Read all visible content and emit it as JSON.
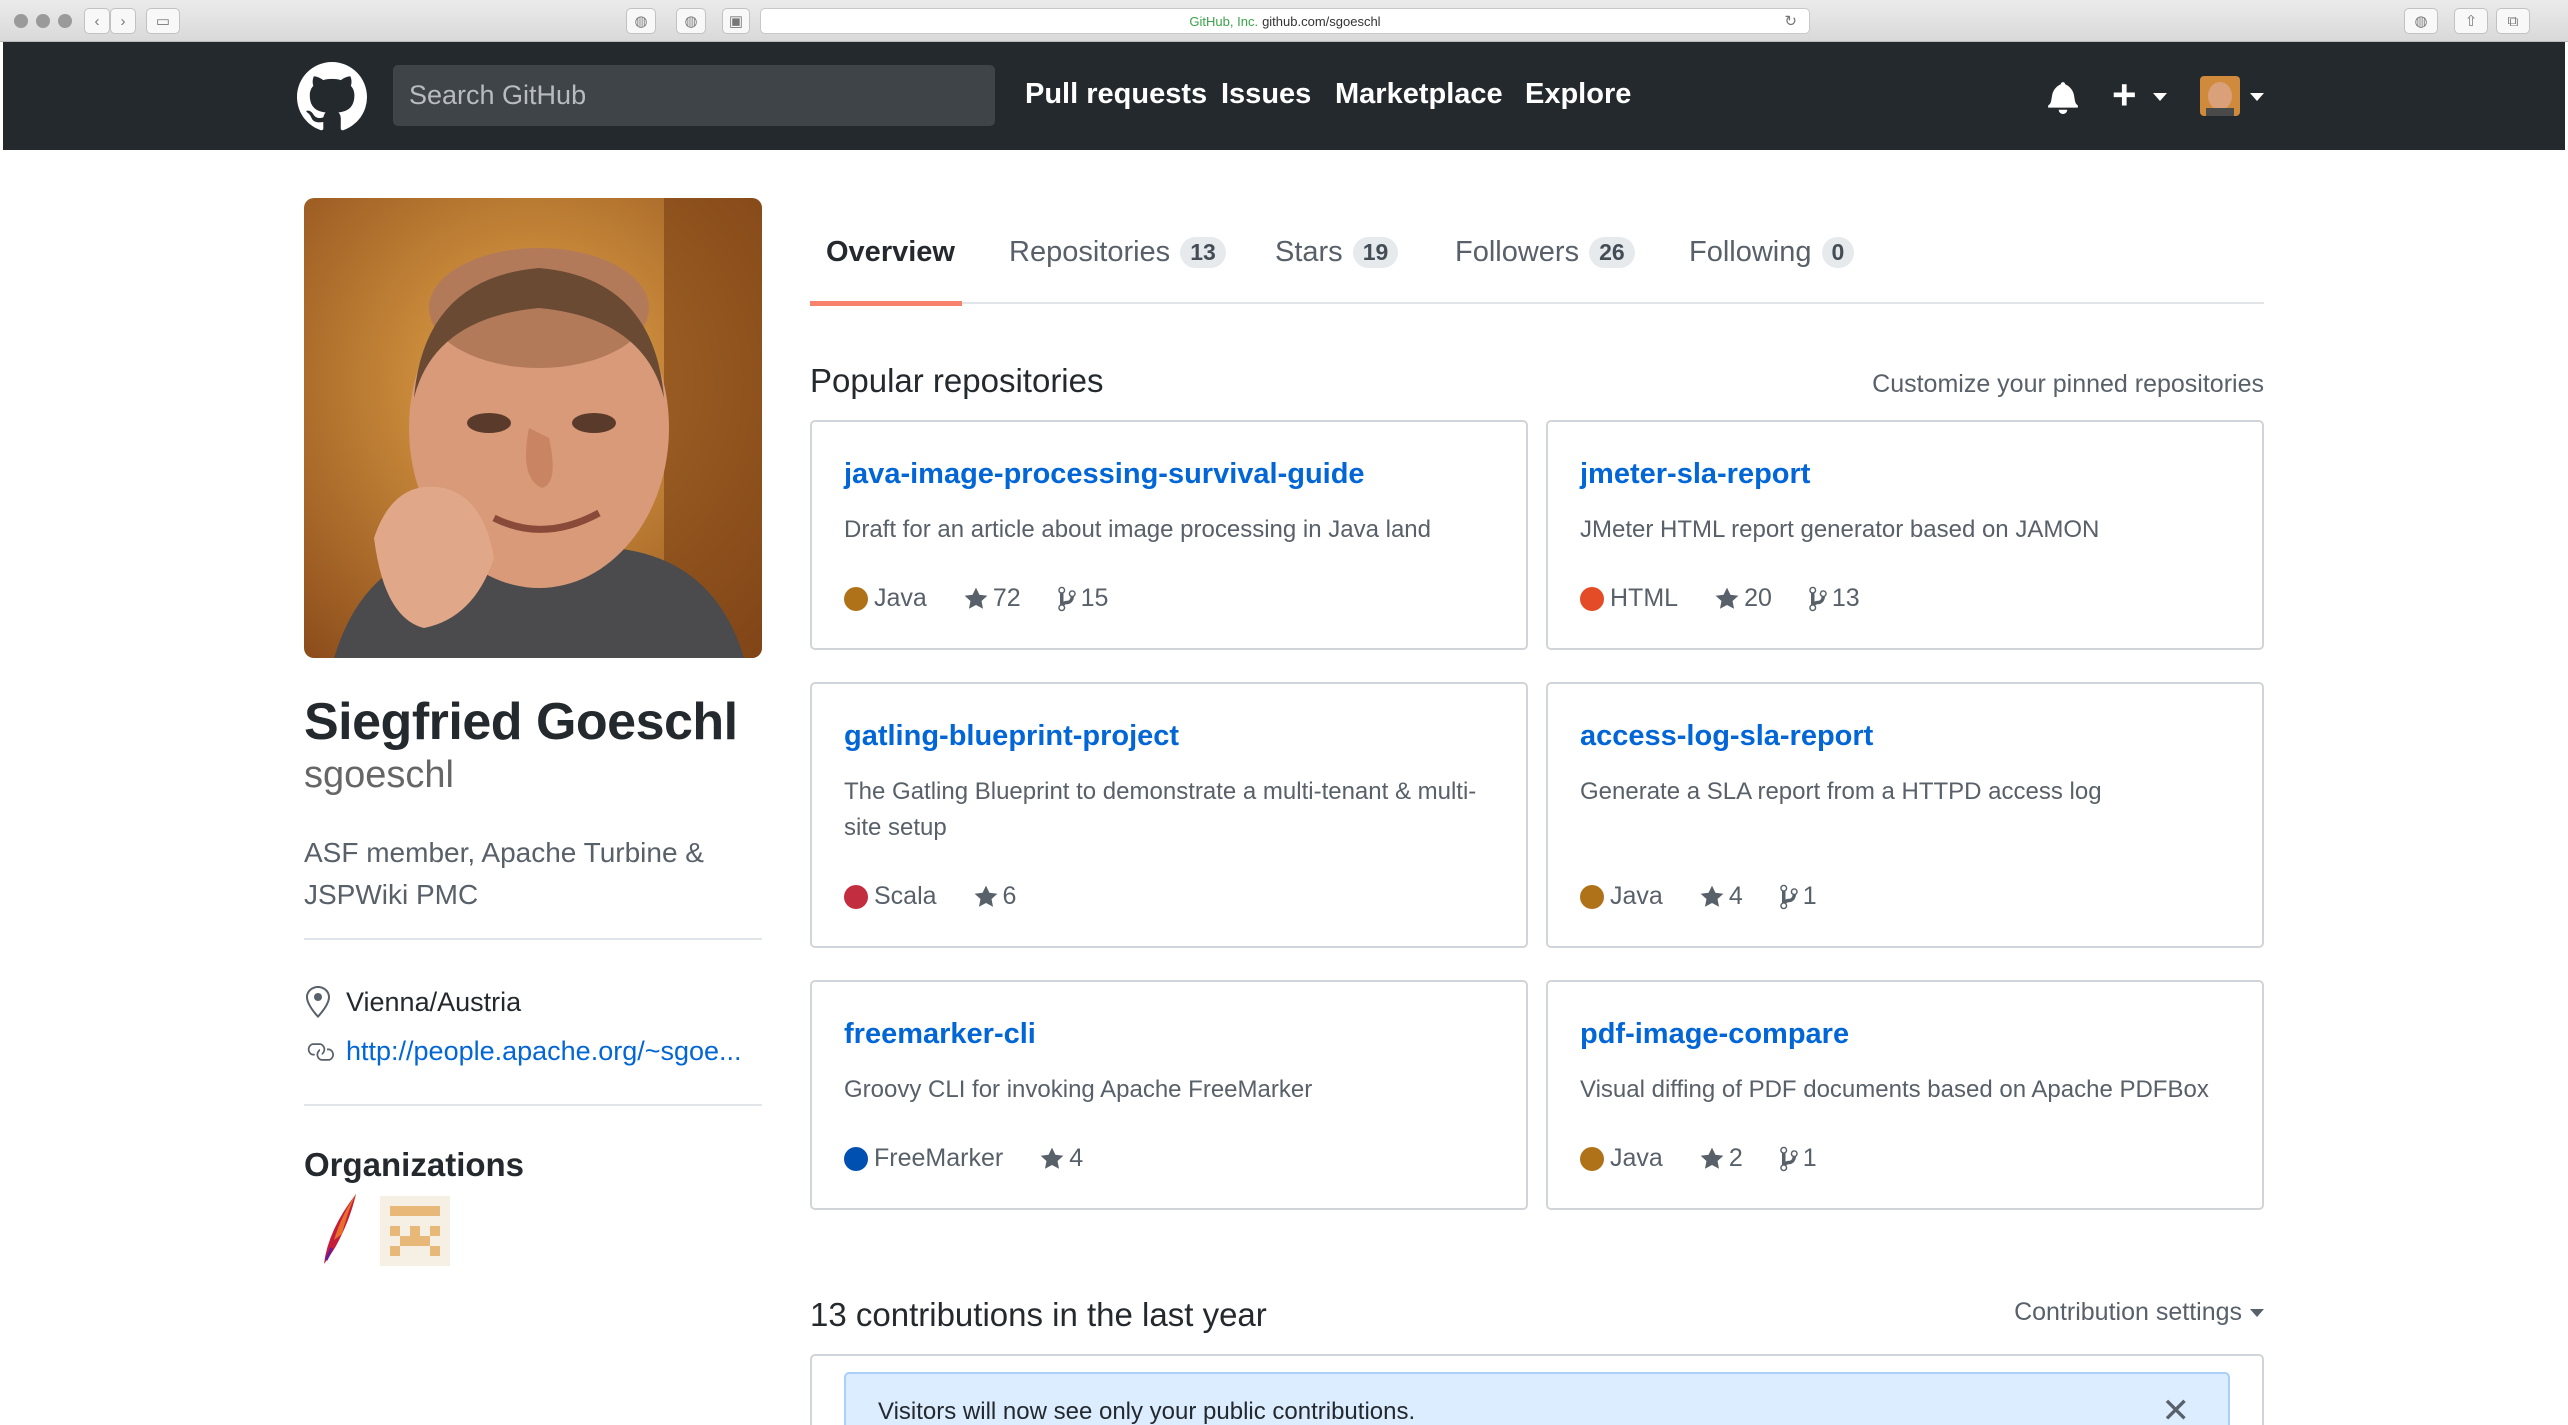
{
  "browser": {
    "address_cert": "GitHub, Inc.",
    "address_url": "github.com/sgoeschl"
  },
  "header": {
    "search_placeholder": "Search GitHub",
    "nav": [
      "Pull requests",
      "Issues",
      "Marketplace",
      "Explore"
    ],
    "colors": {
      "background": "#24292e"
    }
  },
  "profile": {
    "full_name": "Siegfried Goeschl",
    "username": "sgoeschl",
    "bio": "ASF member, Apache Turbine & JSPWiki PMC",
    "location": "Vienna/Austria",
    "website": "http://people.apache.org/~sgoe..."
  },
  "organizations": {
    "title": "Organizations",
    "items": [
      "apache-feather-logo",
      "pixel-grid-logo"
    ]
  },
  "tabs": [
    {
      "label": "Overview",
      "count": null
    },
    {
      "label": "Repositories",
      "count": "13"
    },
    {
      "label": "Stars",
      "count": "19"
    },
    {
      "label": "Followers",
      "count": "26"
    },
    {
      "label": "Following",
      "count": "0"
    }
  ],
  "popular": {
    "title": "Popular repositories",
    "customize_link": "Customize your pinned repositories",
    "repos": [
      {
        "name": "java-image-processing-survival-guide",
        "description": "Draft for an article about image processing in Java land",
        "language": "Java",
        "language_color": "#b07219",
        "stars": "72",
        "forks": "15"
      },
      {
        "name": "jmeter-sla-report",
        "description": "JMeter HTML report generator based on JAMON",
        "language": "HTML",
        "language_color": "#e34c26",
        "stars": "20",
        "forks": "13"
      },
      {
        "name": "gatling-blueprint-project",
        "description": "The Gatling Blueprint to demonstrate a multi-tenant & multi-site setup",
        "language": "Scala",
        "language_color": "#c22d40",
        "stars": "6",
        "forks": null
      },
      {
        "name": "access-log-sla-report",
        "description": "Generate a SLA report from a HTTPD access log",
        "language": "Java",
        "language_color": "#b07219",
        "stars": "4",
        "forks": "1"
      },
      {
        "name": "freemarker-cli",
        "description": "Groovy CLI for invoking Apache FreeMarker",
        "language": "FreeMarker",
        "language_color": "#0050b2",
        "stars": "4",
        "forks": null
      },
      {
        "name": "pdf-image-compare",
        "description": "Visual diffing of PDF documents based on Apache PDFBox",
        "language": "Java",
        "language_color": "#b07219",
        "stars": "2",
        "forks": "1"
      }
    ]
  },
  "contributions": {
    "title": "13 contributions in the last year",
    "settings_label": "Contribution settings",
    "notice": "Visitors will now see only your public contributions."
  }
}
